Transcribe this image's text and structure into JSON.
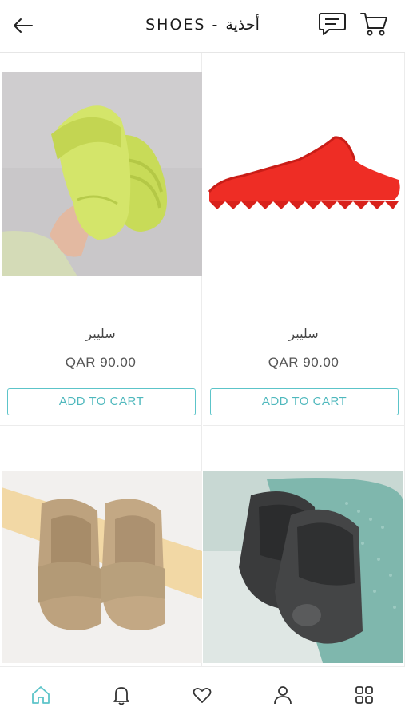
{
  "header": {
    "title": "SHOES - أحذية",
    "back_icon": "arrow-left-icon",
    "chat_icon": "chat-icon",
    "cart_icon": "cart-icon"
  },
  "products": [
    {
      "name": "سليبر",
      "price": "QAR 90.00",
      "button": "ADD TO CART",
      "image": "lime-slide-sandal-in-hand"
    },
    {
      "name": "سليبر",
      "price": "QAR 90.00",
      "button": "ADD TO CART",
      "image": "red-slide-sandal"
    },
    {
      "name": "",
      "price": "",
      "button": "",
      "image": "beige-slide-sandals-pair"
    },
    {
      "name": "",
      "price": "",
      "button": "",
      "image": "black-slide-sandals-pair"
    }
  ],
  "bottom_nav": [
    {
      "icon": "home-icon",
      "active": true
    },
    {
      "icon": "bell-icon",
      "active": false
    },
    {
      "icon": "heart-icon",
      "active": false
    },
    {
      "icon": "user-icon",
      "active": false
    },
    {
      "icon": "grid-icon",
      "active": false
    }
  ],
  "colors": {
    "accent": "#5cc4c9",
    "text": "#222222",
    "muted": "#555555",
    "border": "#ececec"
  }
}
